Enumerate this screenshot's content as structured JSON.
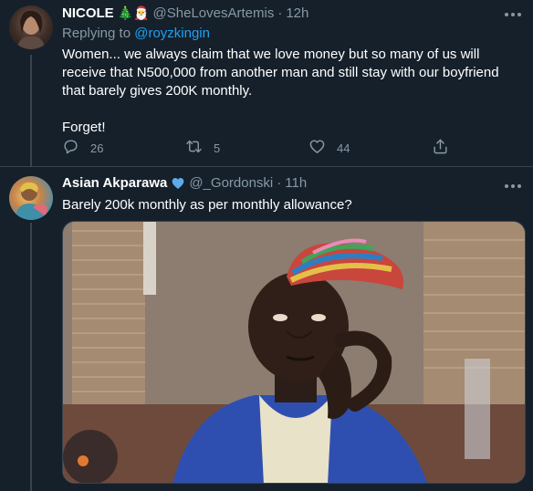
{
  "tweets": [
    {
      "name": "NICOLE",
      "name_emojis": "🎄🎅",
      "handle": "@SheLovesArtemis",
      "separator": "·",
      "time": "12h",
      "replying_prefix": "Replying to",
      "replying_to": "@royzkingin",
      "text": "Women... we always claim that we love money but so many of us will receive that N500,000 from another man and still stay with our boyfriend that barely gives 200K monthly.\n\nForget!",
      "actions": {
        "reply": {
          "icon": "reply-icon",
          "count": "26"
        },
        "retweet": {
          "icon": "retweet-icon",
          "count": "5"
        },
        "like": {
          "icon": "heart-icon",
          "count": "44"
        },
        "share": {
          "icon": "share-icon"
        }
      }
    },
    {
      "name": "Asian Akparawa",
      "verified_icon": "blue-heart-icon",
      "handle": "@_Gordonski",
      "separator": "·",
      "time": "11h",
      "text": "Barely 200k monthly as per monthly allowance?",
      "media_icon": "meme-photo"
    }
  ],
  "colors": {
    "background": "#15202b",
    "primary_text": "#ffffff",
    "secondary_text": "#8899a6",
    "link": "#1da1f2",
    "border": "#38444d"
  }
}
